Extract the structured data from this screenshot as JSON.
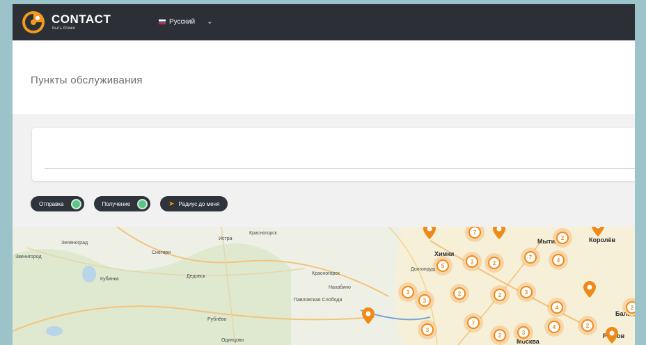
{
  "header": {
    "brand": "CONTACT",
    "brand_sub": "Быть ближе",
    "language": "Русский"
  },
  "page": {
    "title": "Пункты обслуживания"
  },
  "filters": [
    {
      "label": "Отправка",
      "checked": true
    },
    {
      "label": "Получение",
      "checked": true
    },
    {
      "label": "Радиус до меня"
    }
  ],
  "map": {
    "labels": [
      "Истра",
      "Красногорск",
      "Химки",
      "Мытищи",
      "Королёв",
      "Долгопрудный",
      "Зеленоград",
      "Снегири",
      "Дедовск",
      "Нахабино",
      "Павловская Слобода",
      "Красногорск",
      "Звенигород",
      "Кубинка",
      "Рублёво",
      "Одинцово",
      "Москва",
      "Балашиха",
      "Реутов"
    ],
    "clusters": [
      "7",
      "5",
      "3",
      "2",
      "7",
      "4",
      "2",
      "3",
      "3",
      "2",
      "2",
      "3",
      "4",
      "3",
      "7",
      "2",
      "3",
      "4",
      "2",
      "2"
    ],
    "colors": {
      "accent": "#ee8a1a",
      "header": "#2c3036",
      "toggle": "#5cc68a"
    }
  }
}
